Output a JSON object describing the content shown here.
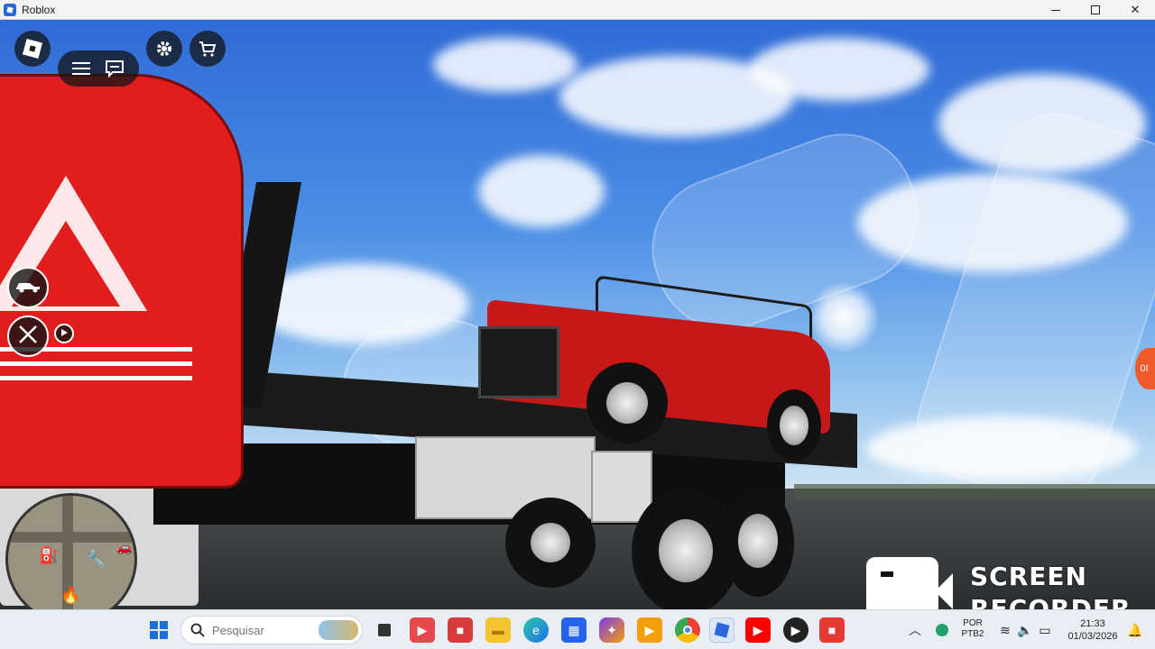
{
  "window": {
    "title": "Roblox",
    "controls": {
      "minimize": "minimize",
      "maximize": "maximize",
      "close": "✕"
    }
  },
  "game": {
    "topbar": {
      "menu_icon": "hamburger-menu-icon",
      "chat_icon": "chat-icon",
      "settings_icon": "gear-icon",
      "shop_icon": "cart-icon"
    },
    "side_controls": {
      "vehicle_icon": "car-icon",
      "exit_icon": "close-icon",
      "play_icon": "play-icon"
    },
    "edge_badge": "0I",
    "minimap_icons": [
      "fuel-icon",
      "repair-icon",
      "fire-icon",
      "vehicle-icon"
    ]
  },
  "watermark": {
    "line1": "SCREEN",
    "line2": "RECORDER"
  },
  "taskbar": {
    "search_placeholder": "Pesquisar",
    "apps": [
      "file-explorer",
      "task-view",
      "media-app",
      "app-red",
      "folder",
      "edge",
      "store",
      "copilot",
      "player",
      "chrome",
      "roblox",
      "youtube",
      "media-player",
      "app-red-2"
    ],
    "tray": {
      "lang_line1": "POR",
      "lang_line2": "PTB2",
      "time": "21:33",
      "date": "01/03/2026"
    }
  },
  "colors": {
    "truck_red": "#e11d1d",
    "taskbar_bg": "#e9eef4",
    "hud_dark": "#141414"
  }
}
